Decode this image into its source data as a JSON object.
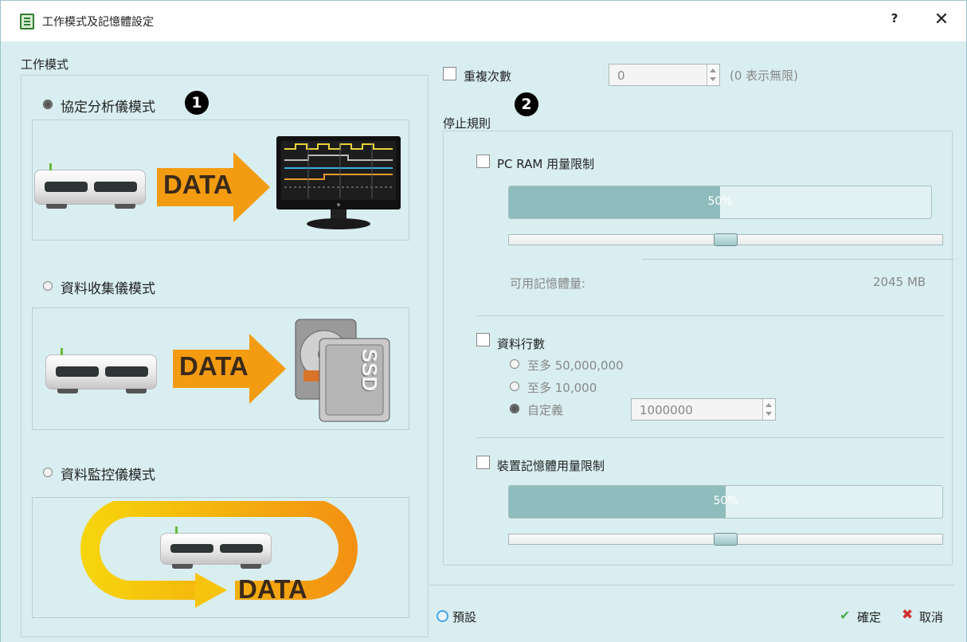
{
  "window": {
    "title": "工作模式及記憶體設定",
    "help_label": "?",
    "close_label": "✕",
    "app_icon": "document-icon"
  },
  "work_mode": {
    "group_label": "工作模式",
    "modes": [
      {
        "label": "協定分析儀模式",
        "selected": true,
        "badge": "1",
        "image": "device-to-monitor",
        "image_text": "DATA"
      },
      {
        "label": "資料收集儀模式",
        "selected": false,
        "image": "device-to-storage",
        "image_text": "DATA",
        "drive_label": "SSD"
      },
      {
        "label": "資料監控儀模式",
        "selected": false,
        "image": "device-loop",
        "image_text": "DATA"
      }
    ]
  },
  "repeat": {
    "label": "重複次數",
    "checked": false,
    "value": "0",
    "hint": "(0 表示無限)"
  },
  "stop_rules": {
    "label": "停止規則",
    "badge": "2",
    "pc_ram": {
      "label": "PC RAM 用量限制",
      "checked": false,
      "progress_text": "50%",
      "progress": 0.5,
      "slider": 0.5,
      "available_label": "可用記憶體量:",
      "available_value": "2045 MB"
    },
    "row_count": {
      "label": "資料行數",
      "checked": false,
      "options": [
        {
          "label": "至多 50,000,000",
          "selected": false
        },
        {
          "label": "至多 10,000",
          "selected": false
        },
        {
          "label": "自定義",
          "selected": true
        }
      ],
      "custom_value": "1000000"
    },
    "device_mem": {
      "label": "裝置記憶體用量限制",
      "checked": false,
      "progress_text": "50%",
      "progress": 0.5,
      "slider": 0.5
    }
  },
  "footer": {
    "default_label": "預設",
    "ok_label": "確定",
    "cancel_label": "取消"
  },
  "colors": {
    "client_bg": "#d9eef0",
    "arrow_orange": "#f39c12",
    "loop_yellow": "#f6d40c",
    "ok_green": "#4caf50",
    "cancel_red": "#d32f2f"
  }
}
